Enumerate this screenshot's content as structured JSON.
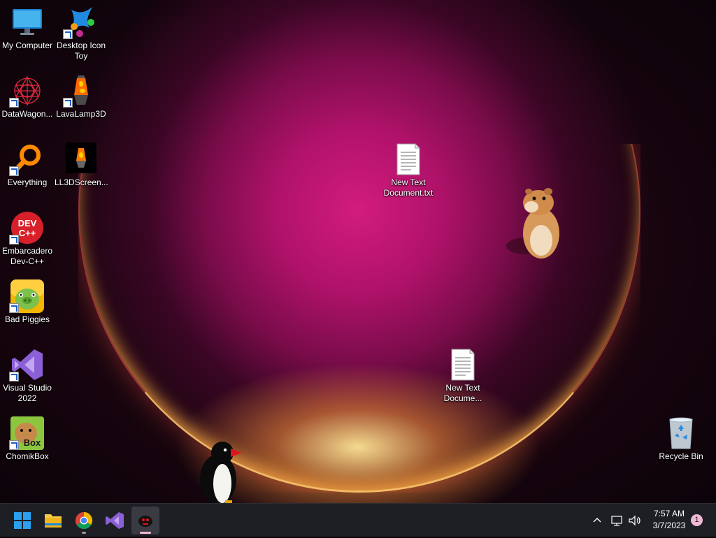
{
  "desktop": {
    "icons": [
      {
        "name": "my-computer",
        "label": "My Computer"
      },
      {
        "name": "desktop-icon-toy",
        "label": "Desktop Icon\nToy"
      },
      {
        "name": "datawagon",
        "label": "DataWagon..."
      },
      {
        "name": "lavalamp3d",
        "label": "LavaLamp3D"
      },
      {
        "name": "everything",
        "label": "Everything"
      },
      {
        "name": "ll3dscreen",
        "label": "LL3DScreen..."
      },
      {
        "name": "embarcadero-dev-cpp",
        "label": "Embarcadero\nDev-C++",
        "badge": "DEV\nC++"
      },
      {
        "name": "bad-piggies",
        "label": "Bad Piggies"
      },
      {
        "name": "visual-studio-2022",
        "label": "Visual Studio\n2022"
      },
      {
        "name": "chomikbox",
        "label": "ChomikBox",
        "badge": "Box"
      },
      {
        "name": "new-text-document-1",
        "label": "New Text\nDocument.txt"
      },
      {
        "name": "new-text-document-2",
        "label": "New Text\nDocume..."
      },
      {
        "name": "recycle-bin",
        "label": "Recycle Bin"
      }
    ]
  },
  "taskbar": {
    "apps": [
      "start-icon",
      "file-explorer-icon",
      "chrome-icon",
      "visual-studio-icon",
      "penguin-app-icon"
    ],
    "active_app": "penguin-app-icon",
    "clock_time": "7:57 AM",
    "clock_date": "3/7/2023",
    "notification_count": "1"
  }
}
